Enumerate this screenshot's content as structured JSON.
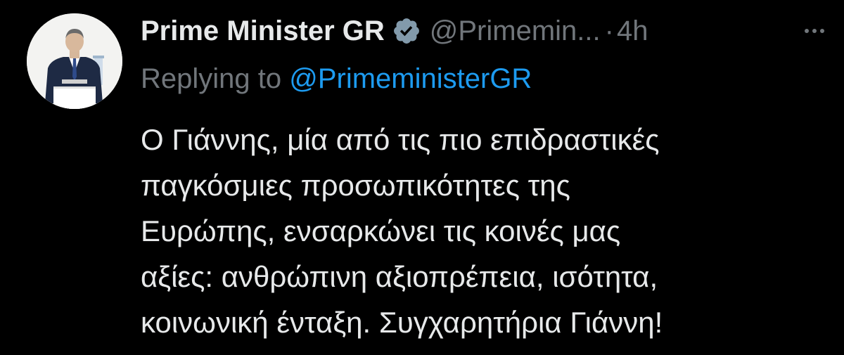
{
  "tweet": {
    "display_name": "Prime Minister GR",
    "verified_icon": "verified-badge-icon",
    "handle": "@Primemin...",
    "separator": "·",
    "time": "4h",
    "more_icon": "more-options-icon",
    "reply": {
      "prefix": "Replying to ",
      "mention": "@PrimeministerGR"
    },
    "body_lines": [
      "Ο Γιάννης, μία από τις πιο επιδραστικές",
      "παγκόσμιες προσωπικότητες της",
      "Ευρώπης, ενσαρκώνει τις κοινές μας",
      "αξίες: ανθρώπινη αξιοπρέπεια, ισότητα,",
      "κοινωνική ένταξη. Συγχαρητήρια Γιάννη!"
    ]
  },
  "colors": {
    "background": "#000000",
    "text": "#e7e9ea",
    "muted": "#71767b",
    "link": "#1d9bf0",
    "verified_badge": "#829aab"
  }
}
